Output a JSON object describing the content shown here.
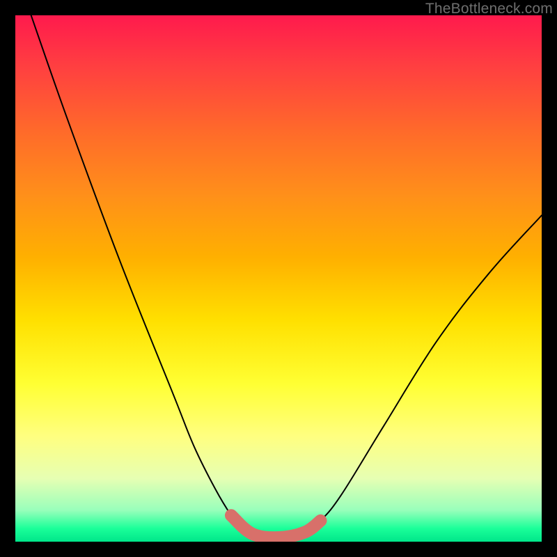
{
  "watermark": "TheBottleneck.com",
  "chart_data": {
    "type": "line",
    "title": "",
    "xlabel": "",
    "ylabel": "",
    "xlim": [
      0,
      100
    ],
    "ylim": [
      0,
      100
    ],
    "grid": false,
    "legend": false,
    "series": [
      {
        "name": "curve",
        "x": [
          3,
          10,
          20,
          30,
          34,
          38,
          41,
          43,
          45,
          47,
          50,
          53,
          55,
          58,
          62,
          70,
          80,
          90,
          100
        ],
        "y": [
          100,
          80,
          53,
          28,
          18,
          10,
          5,
          2.5,
          1.5,
          1,
          0.8,
          1,
          1.8,
          4,
          9,
          22,
          38,
          51,
          62
        ]
      },
      {
        "name": "highlight",
        "x": [
          41,
          45,
          50,
          55,
          58
        ],
        "y": [
          5,
          1.5,
          0.8,
          1.8,
          4
        ]
      }
    ],
    "annotations": []
  }
}
